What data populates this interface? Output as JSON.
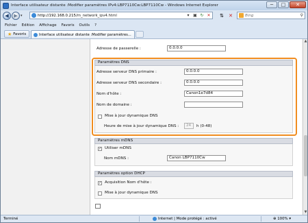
{
  "window": {
    "title": "Interface utilisateur distante :Modifier paramètres IPv4:LBP7110Cw:LBP7110Cw - Windows Internet Explorer",
    "controls": {
      "minimize": "─",
      "maximize": "□",
      "close": "✕"
    }
  },
  "address_bar": {
    "url_host": "http://192.168.0.215",
    "url_path": "/m_network_ipv4.html",
    "search_placeholder": "Bing"
  },
  "menu": [
    "Fichier",
    "Edition",
    "Affichage",
    "Favoris",
    "Outils",
    "?"
  ],
  "favorites": {
    "button_label": "Favoris",
    "tab_label": "Interface utilisateur distante :Modifier paramètres..."
  },
  "form": {
    "gateway": {
      "label": "Adresse de passerelle :",
      "value": "0.0.0.0"
    },
    "dns": {
      "header": "Paramètres DNS",
      "primary": {
        "label": "Adresse serveur DNS primaire :",
        "value": "0.0.0.0"
      },
      "secondary": {
        "label": "Adresse serveur DNS secondaire :",
        "value": "0.0.0.0"
      },
      "hostname": {
        "label": "Nom d'hôte :",
        "value": "Canon1e7d84"
      },
      "domain": {
        "label": "Nom de domaine :",
        "value": ""
      },
      "dynamic_update": {
        "label": "Mise à jour dynamique DNS",
        "checked": false
      },
      "update_time": {
        "label": "Heure de mise à jour dynamique DNS :",
        "value": "24",
        "unit": "h (0-48)"
      }
    },
    "mdns": {
      "header": "Paramètres mDNS",
      "use": {
        "label": "Utiliser mDNS",
        "checked": true
      },
      "name": {
        "label": "Nom mDNS :",
        "value": "Canon LBP7110Cw"
      }
    },
    "dhcp": {
      "header": "Paramètres option DHCP",
      "acquire_hostname": {
        "label": "Acquisition Nom d'hôte :",
        "checked": true
      },
      "dynamic_update": {
        "label": "Mise à jour dynamique DNS",
        "checked": false
      }
    }
  },
  "status": {
    "left": "Terminé",
    "zone": "Internet | Mode protégé : activé",
    "zoom": "100%"
  },
  "colors": {
    "highlight": "#f08c1e",
    "section_header": "#d9dce3"
  }
}
